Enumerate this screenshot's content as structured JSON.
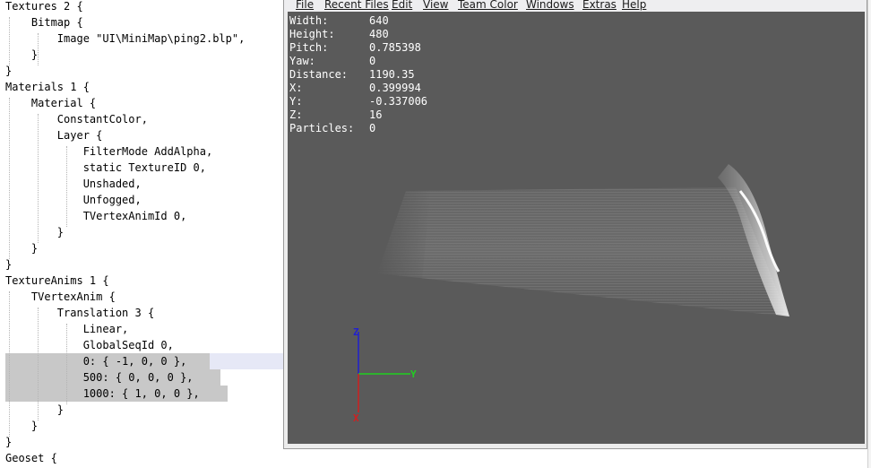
{
  "editor": {
    "lines": [
      "Textures 2 {",
      "    Bitmap {",
      "        Image \"UI\\MiniMap\\ping2.blp\",",
      "    }",
      "}",
      "Materials 1 {",
      "    Material {",
      "        ConstantColor,",
      "        Layer {",
      "            FilterMode AddAlpha,",
      "            static TextureID 0,",
      "            Unshaded,",
      "            Unfogged,",
      "            TVertexAnimId 0,",
      "        }",
      "    }",
      "}",
      "TextureAnims 1 {",
      "    TVertexAnim {",
      "        Translation 3 {",
      "            Linear,",
      "            GlobalSeqId 0,",
      "            0: { -1, 0, 0 },",
      "            500: { 0, 0, 0 },",
      "            1000: { 1, 0, 0 },",
      "        }",
      "    }",
      "}",
      "Geoset {"
    ]
  },
  "viewer": {
    "menu": [
      "File",
      "Recent Files",
      "Edit",
      "View",
      "Team Color",
      "Windows",
      "Extras",
      "Help"
    ],
    "stats": [
      {
        "label": "Width:",
        "value": "640"
      },
      {
        "label": "Height:",
        "value": "480"
      },
      {
        "label": "Pitch:",
        "value": "0.785398"
      },
      {
        "label": "Yaw:",
        "value": "0"
      },
      {
        "label": "Distance:",
        "value": "1190.35"
      },
      {
        "label": "X:",
        "value": "0.399994"
      },
      {
        "label": "Y:",
        "value": "-0.337006"
      },
      {
        "label": "Z:",
        "value": "16"
      },
      {
        "label": "Particles:",
        "value": "0"
      }
    ],
    "axes": {
      "z": "Z",
      "y": "Y",
      "x": "X"
    },
    "colors": {
      "viewport_bg": "#5a5a5a",
      "axis_x": "#d02020",
      "axis_y": "#20d020",
      "axis_z": "#2020d0"
    }
  }
}
